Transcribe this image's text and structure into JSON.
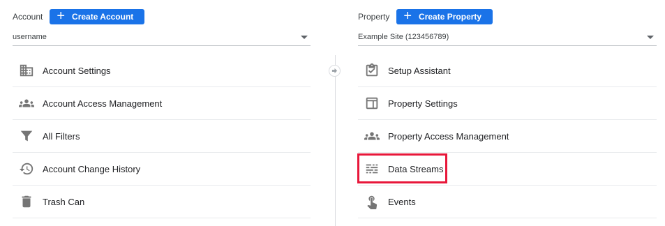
{
  "account": {
    "label": "Account",
    "create_button": "Create Account",
    "selected": "username",
    "items": [
      {
        "label": "Account Settings",
        "icon": "building-icon"
      },
      {
        "label": "Account Access Management",
        "icon": "people-icon"
      },
      {
        "label": "All Filters",
        "icon": "filter-icon"
      },
      {
        "label": "Account Change History",
        "icon": "history-icon"
      },
      {
        "label": "Trash Can",
        "icon": "trash-icon"
      }
    ]
  },
  "property": {
    "label": "Property",
    "create_button": "Create Property",
    "selected": "Example Site (123456789)",
    "items": [
      {
        "label": "Setup Assistant",
        "icon": "clipboard-check-icon"
      },
      {
        "label": "Property Settings",
        "icon": "layout-icon"
      },
      {
        "label": "Property Access Management",
        "icon": "people-icon"
      },
      {
        "label": "Data Streams",
        "icon": "streams-icon",
        "highlighted": true
      },
      {
        "label": "Events",
        "icon": "touch-icon"
      }
    ]
  },
  "colors": {
    "accent": "#1a73e8",
    "highlight": "#e8173a",
    "icon": "#757575"
  }
}
